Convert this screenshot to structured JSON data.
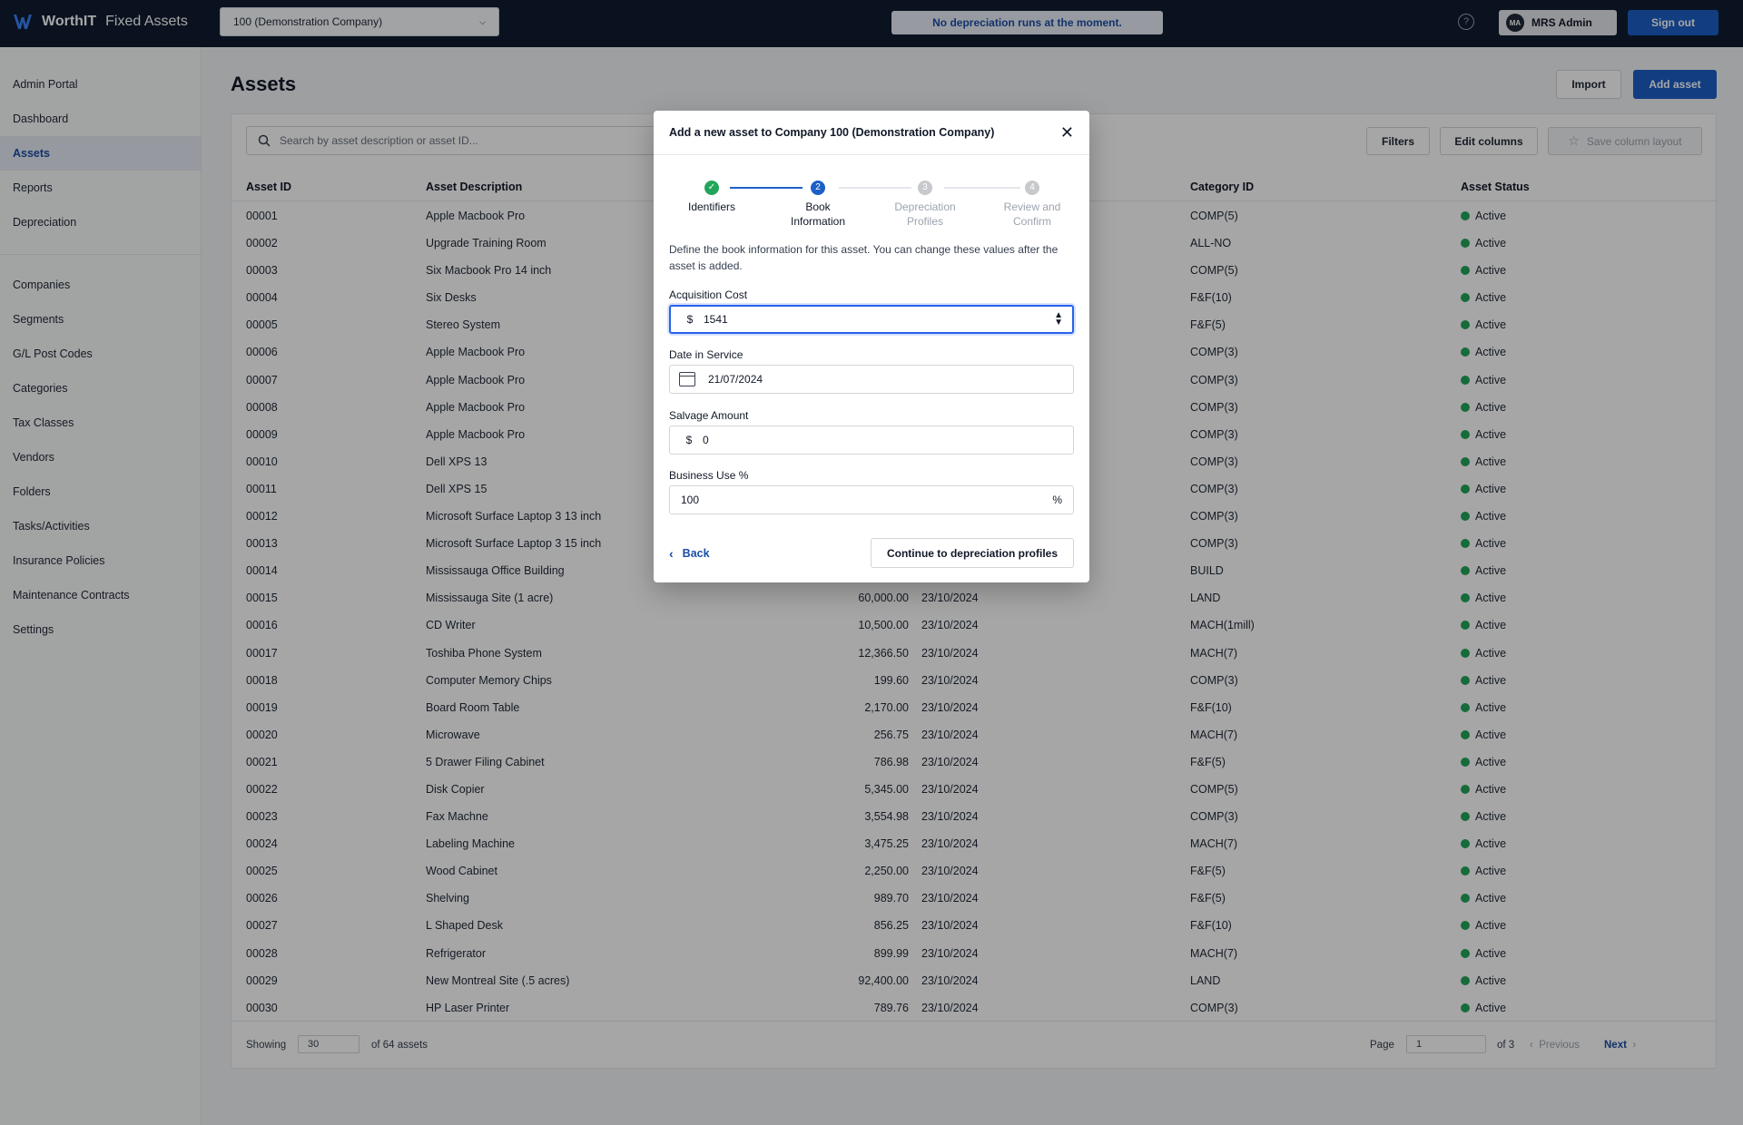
{
  "header": {
    "brand_bold": "WorthIT",
    "brand_rest": "Fixed Assets",
    "company": "100 (Demonstration Company)",
    "notice": "No depreciation runs at the moment.",
    "user_initials": "MA",
    "user_name": "MRS Admin",
    "signout": "Sign out"
  },
  "sidebar": {
    "primary": [
      "Admin Portal",
      "Dashboard",
      "Assets",
      "Reports",
      "Depreciation"
    ],
    "secondary": [
      "Companies",
      "Segments",
      "G/L Post Codes",
      "Categories",
      "Tax Classes",
      "Vendors",
      "Folders",
      "Tasks/Activities",
      "Insurance Policies",
      "Maintenance Contracts",
      "Settings"
    ],
    "active": "Assets"
  },
  "page": {
    "title": "Assets",
    "import": "Import",
    "add_asset": "Add asset",
    "search_placeholder": "Search by asset description or asset ID...",
    "filters": "Filters",
    "edit_columns": "Edit columns",
    "save_layout": "Save column layout"
  },
  "table": {
    "headers": {
      "id": "Asset ID",
      "desc": "Asset Description",
      "category": "Category ID",
      "status": "Asset Status"
    },
    "rows": [
      {
        "id": "00001",
        "desc": "Apple Macbook Pro",
        "cost": "",
        "date": "",
        "cat": "COMP(5)",
        "status": "Active"
      },
      {
        "id": "00002",
        "desc": "Upgrade Training Room",
        "cost": "",
        "date": "",
        "cat": "ALL-NO",
        "status": "Active"
      },
      {
        "id": "00003",
        "desc": "Six Macbook Pro 14 inch",
        "cost": "",
        "date": "",
        "cat": "COMP(5)",
        "status": "Active"
      },
      {
        "id": "00004",
        "desc": "Six Desks",
        "cost": "",
        "date": "",
        "cat": "F&F(10)",
        "status": "Active"
      },
      {
        "id": "00005",
        "desc": "Stereo System",
        "cost": "",
        "date": "",
        "cat": "F&F(5)",
        "status": "Active"
      },
      {
        "id": "00006",
        "desc": "Apple Macbook Pro",
        "cost": "",
        "date": "",
        "cat": "COMP(3)",
        "status": "Active"
      },
      {
        "id": "00007",
        "desc": "Apple Macbook Pro",
        "cost": "",
        "date": "",
        "cat": "COMP(3)",
        "status": "Active"
      },
      {
        "id": "00008",
        "desc": "Apple Macbook Pro",
        "cost": "",
        "date": "",
        "cat": "COMP(3)",
        "status": "Active"
      },
      {
        "id": "00009",
        "desc": "Apple Macbook Pro",
        "cost": "",
        "date": "",
        "cat": "COMP(3)",
        "status": "Active"
      },
      {
        "id": "00010",
        "desc": "Dell XPS 13",
        "cost": "",
        "date": "",
        "cat": "COMP(3)",
        "status": "Active"
      },
      {
        "id": "00011",
        "desc": "Dell XPS 15",
        "cost": "",
        "date": "",
        "cat": "COMP(3)",
        "status": "Active"
      },
      {
        "id": "00012",
        "desc": "Microsoft Surface Laptop 3 13 inch",
        "cost": "",
        "date": "",
        "cat": "COMP(3)",
        "status": "Active"
      },
      {
        "id": "00013",
        "desc": "Microsoft Surface Laptop 3 15 inch",
        "cost": "",
        "date": "",
        "cat": "COMP(3)",
        "status": "Active"
      },
      {
        "id": "00014",
        "desc": "Mississauga Office Building",
        "cost": "",
        "date": "",
        "cat": "BUILD",
        "status": "Active"
      },
      {
        "id": "00015",
        "desc": "Mississauga Site (1 acre)",
        "cost": "60,000.00",
        "date": "23/10/2024",
        "cat": "LAND",
        "status": "Active"
      },
      {
        "id": "00016",
        "desc": "CD Writer",
        "cost": "10,500.00",
        "date": "23/10/2024",
        "cat": "MACH(1mill)",
        "status": "Active"
      },
      {
        "id": "00017",
        "desc": "Toshiba Phone System",
        "cost": "12,366.50",
        "date": "23/10/2024",
        "cat": "MACH(7)",
        "status": "Active"
      },
      {
        "id": "00018",
        "desc": "Computer Memory Chips",
        "cost": "199.60",
        "date": "23/10/2024",
        "cat": "COMP(3)",
        "status": "Active"
      },
      {
        "id": "00019",
        "desc": "Board Room Table",
        "cost": "2,170.00",
        "date": "23/10/2024",
        "cat": "F&F(10)",
        "status": "Active"
      },
      {
        "id": "00020",
        "desc": "Microwave",
        "cost": "256.75",
        "date": "23/10/2024",
        "cat": "MACH(7)",
        "status": "Active"
      },
      {
        "id": "00021",
        "desc": "5 Drawer Filing Cabinet",
        "cost": "786.98",
        "date": "23/10/2024",
        "cat": "F&F(5)",
        "status": "Active"
      },
      {
        "id": "00022",
        "desc": "Disk Copier",
        "cost": "5,345.00",
        "date": "23/10/2024",
        "cat": "COMP(5)",
        "status": "Active"
      },
      {
        "id": "00023",
        "desc": "Fax Machne",
        "cost": "3,554.98",
        "date": "23/10/2024",
        "cat": "COMP(3)",
        "status": "Active"
      },
      {
        "id": "00024",
        "desc": "Labeling Machine",
        "cost": "3,475.25",
        "date": "23/10/2024",
        "cat": "MACH(7)",
        "status": "Active"
      },
      {
        "id": "00025",
        "desc": "Wood Cabinet",
        "cost": "2,250.00",
        "date": "23/10/2024",
        "cat": "F&F(5)",
        "status": "Active"
      },
      {
        "id": "00026",
        "desc": "Shelving",
        "cost": "989.70",
        "date": "23/10/2024",
        "cat": "F&F(5)",
        "status": "Active"
      },
      {
        "id": "00027",
        "desc": "L Shaped Desk",
        "cost": "856.25",
        "date": "23/10/2024",
        "cat": "F&F(10)",
        "status": "Active"
      },
      {
        "id": "00028",
        "desc": "Refrigerator",
        "cost": "899.99",
        "date": "23/10/2024",
        "cat": "MACH(7)",
        "status": "Active"
      },
      {
        "id": "00029",
        "desc": "New Montreal Site (.5 acres)",
        "cost": "92,400.00",
        "date": "23/10/2024",
        "cat": "LAND",
        "status": "Active"
      },
      {
        "id": "00030",
        "desc": "HP Laser Printer",
        "cost": "789.76",
        "date": "23/10/2024",
        "cat": "COMP(3)",
        "status": "Active"
      }
    ]
  },
  "footer": {
    "showing": "Showing",
    "page_size": "30",
    "of_assets": "of 64 assets",
    "page_label": "Page",
    "page_value": "1",
    "of_pages": "of 3",
    "previous": "Previous",
    "next": "Next"
  },
  "modal": {
    "title": "Add a new asset to Company 100 (Demonstration Company)",
    "steps": [
      {
        "num": "✓",
        "label": "Identifiers",
        "state": "done"
      },
      {
        "num": "2",
        "label": "Book Information",
        "state": "current"
      },
      {
        "num": "3",
        "label": "Depreciation Profiles",
        "state": "future"
      },
      {
        "num": "4",
        "label": "Review and Confirm",
        "state": "future"
      }
    ],
    "description": "Define the book information for this asset. You can change these values after the asset is added.",
    "acq_label": "Acquisition Cost",
    "acq_prefix": "$",
    "acq_value": "1541",
    "date_label": "Date in Service",
    "date_value": "21/07/2024",
    "salvage_label": "Salvage Amount",
    "salvage_prefix": "$",
    "salvage_value": "0",
    "business_label": "Business Use %",
    "business_value": "100",
    "business_suffix": "%",
    "back": "Back",
    "continue": "Continue to depreciation profiles"
  },
  "colors": {
    "accent": "#1d5fc7",
    "topbar": "#0f1c2e",
    "status_active": "#22a55a"
  }
}
